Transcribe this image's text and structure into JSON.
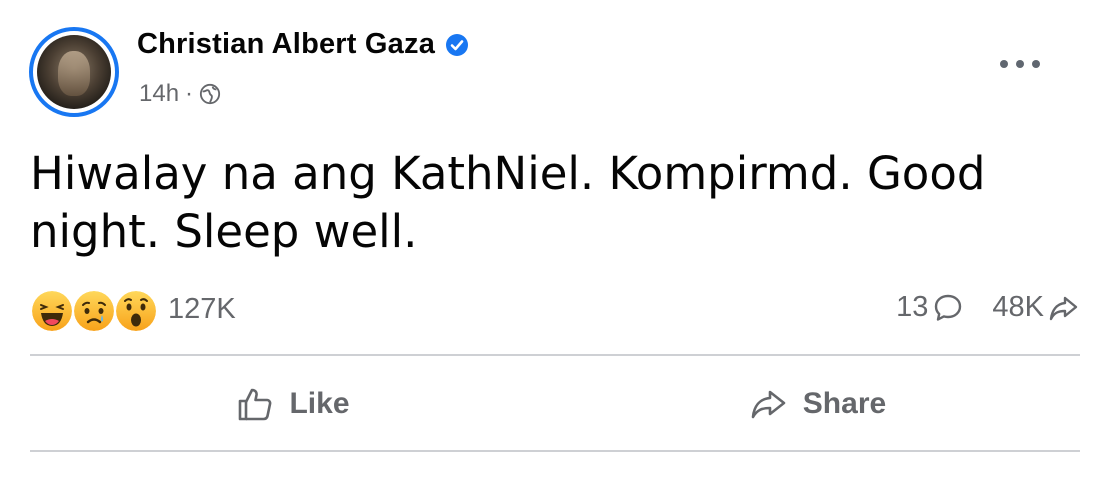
{
  "post": {
    "author": {
      "name": "Christian Albert Gaza",
      "verified_icon": "verified-badge-icon",
      "avatar": "avatar"
    },
    "meta": {
      "time": "14h",
      "separator": "·",
      "audience_icon": "globe-icon"
    },
    "more_icon": "more-options-icon",
    "text": "Hiwalay na ang KathNiel. Kompirmd. Good night. Sleep well.",
    "reactions": {
      "icons": [
        "haha-icon",
        "sad-icon",
        "wow-icon"
      ],
      "total": "127K"
    },
    "comments": {
      "count": "13",
      "icon": "comment-icon"
    },
    "shares": {
      "count": "48K",
      "icon": "share-arrow-icon"
    },
    "actions": {
      "like_label": "Like",
      "like_icon": "thumbs-up-icon",
      "share_label": "Share",
      "share_icon": "share-icon"
    },
    "colors": {
      "accent": "#1877f2",
      "secondary_text": "#65676b",
      "primary_text": "#050505",
      "divider": "#ced0d4"
    }
  }
}
